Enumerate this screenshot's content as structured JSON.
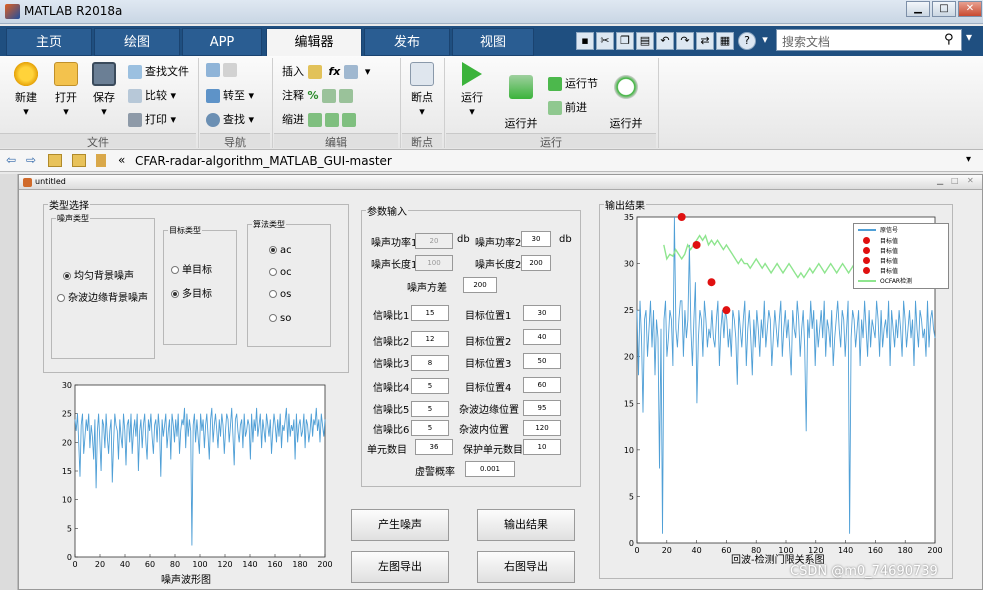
{
  "window": {
    "title": "MATLAB R2018a",
    "min": "▁",
    "max": "□",
    "close": "✕"
  },
  "tabs": [
    {
      "label": "主页"
    },
    {
      "label": "绘图"
    },
    {
      "label": "APP"
    },
    {
      "label": "编辑器"
    },
    {
      "label": "发布"
    },
    {
      "label": "视图"
    }
  ],
  "search": {
    "placeholder": "搜索文档"
  },
  "ribbon": {
    "file": {
      "new": "新建",
      "open": "打开",
      "save": "保存",
      "find_files": "查找文件",
      "compare": "比较",
      "print": "打印",
      "group": "文件"
    },
    "nav": {
      "goto": "转至",
      "find": "查找",
      "group": "导航"
    },
    "edit": {
      "insert": "插入",
      "comment": "注释",
      "indent": "缩进",
      "fx": "fx",
      "group": "编辑"
    },
    "breakpoint": {
      "label": "断点",
      "group": "断点"
    },
    "run": {
      "run": "运行",
      "run_advance": "运行并\n前进",
      "run_section": "运行节",
      "advance": "前进",
      "run_time": "运行并\n计时",
      "group": "运行"
    }
  },
  "path": {
    "text": "CFAR-radar-algorithm_MATLAB_GUI-master",
    "chev": "«"
  },
  "figure": {
    "title": "untitled"
  },
  "type_panel": {
    "title": "类型选择",
    "noise": {
      "title": "噪声类型",
      "options": [
        "均匀背景噪声",
        "杂波边缘背景噪声"
      ]
    },
    "target": {
      "title": "目标类型",
      "options": [
        "单目标",
        "多目标"
      ]
    },
    "algo": {
      "title": "算法类型",
      "options": [
        "ac",
        "oc",
        "os",
        "so"
      ]
    }
  },
  "params": {
    "title": "参数输入",
    "noise_power1": {
      "label": "噪声功率1",
      "value": "20",
      "unit": "db"
    },
    "noise_power2": {
      "label": "噪声功率2",
      "value": "30",
      "unit": "db"
    },
    "noise_len1": {
      "label": "噪声长度1",
      "value": "100"
    },
    "noise_len2": {
      "label": "噪声长度2",
      "value": "200"
    },
    "noise_var": {
      "label": "噪声方差",
      "value": "200"
    },
    "snr": [
      {
        "label": "信噪比1",
        "value": "15"
      },
      {
        "label": "信噪比2",
        "value": "12"
      },
      {
        "label": "信噪比3",
        "value": "8"
      },
      {
        "label": "信噪比4",
        "value": "5"
      },
      {
        "label": "信噪比5",
        "value": "5"
      },
      {
        "label": "信噪比6",
        "value": "5"
      }
    ],
    "pos": [
      {
        "label": "目标位置1",
        "value": "30"
      },
      {
        "label": "目标位置2",
        "value": "40"
      },
      {
        "label": "目标位置3",
        "value": "50"
      },
      {
        "label": "目标位置4",
        "value": "60"
      },
      {
        "label": "杂波边缘位置",
        "value": "95"
      },
      {
        "label": "杂波内位置",
        "value": "120"
      }
    ],
    "cells": {
      "label": "单元数目",
      "value": "36"
    },
    "guard": {
      "label": "保护单元数目",
      "value": "10"
    },
    "pfa": {
      "label": "虚警概率",
      "value": "0.001"
    }
  },
  "buttons": {
    "gen_noise": "产生噪声",
    "output": "输出结果",
    "left_export": "左图导出",
    "right_export": "右图导出"
  },
  "chart_data": [
    {
      "type": "line",
      "title": "",
      "xlabel": "噪声波形图",
      "ylabel": "",
      "xlim": [
        0,
        200
      ],
      "ylim": [
        0,
        30
      ],
      "xticks": [
        "0",
        "20",
        "40",
        "60",
        "80",
        "100",
        "120",
        "140",
        "160",
        "180",
        "200"
      ],
      "yticks": [
        "0",
        "5",
        "10",
        "15",
        "20",
        "25",
        "30"
      ],
      "series": [
        {
          "color": "#4f9fd6",
          "values": [
            24,
            22,
            25,
            20,
            14,
            23,
            25,
            18,
            21,
            24,
            22,
            25,
            19,
            23,
            21,
            17,
            24,
            12,
            22,
            25,
            20,
            15,
            24,
            23,
            19,
            25,
            21,
            18,
            22,
            24,
            13,
            20,
            25,
            23,
            22,
            17,
            24,
            21,
            19,
            25,
            22,
            16,
            23,
            24,
            20,
            25,
            18,
            22,
            24,
            21,
            25,
            15,
            22,
            24,
            19,
            23,
            25,
            20,
            17,
            24,
            22,
            25,
            21,
            18,
            23,
            24,
            20,
            25,
            22,
            14,
            24,
            21,
            23,
            25,
            19,
            22,
            24,
            17,
            25,
            23,
            20,
            24,
            21,
            25,
            18,
            22,
            24,
            23,
            26,
            19,
            25,
            21,
            24,
            22,
            2,
            23,
            25,
            20,
            24,
            21,
            18,
            25,
            22,
            24,
            19,
            23,
            25,
            21,
            17,
            24,
            26,
            20,
            23,
            25,
            22,
            19,
            24,
            21,
            25,
            23,
            18,
            22,
            25,
            24,
            20,
            23,
            26,
            21,
            16,
            24,
            25,
            22,
            20,
            23,
            24,
            19,
            25,
            21,
            22,
            24,
            23,
            17,
            25,
            20,
            24,
            22,
            26,
            21,
            23,
            25,
            19,
            24,
            22,
            20,
            25,
            23,
            21,
            24,
            18,
            22,
            25,
            23,
            20,
            24,
            21,
            25,
            19,
            23,
            22,
            24,
            26,
            20,
            25,
            21,
            23,
            22,
            24,
            17,
            25,
            20,
            23,
            24,
            21,
            22,
            25,
            19,
            24,
            23,
            20,
            22,
            25,
            21,
            24,
            23,
            26,
            22,
            24,
            20,
            25,
            23,
            21,
            24
          ]
        }
      ]
    },
    {
      "type": "line",
      "title": "输出结果",
      "xlabel": "回波-检测门限关系图",
      "ylabel": "",
      "xlim": [
        0,
        200
      ],
      "ylim": [
        0,
        35
      ],
      "xticks": [
        "0",
        "20",
        "40",
        "60",
        "80",
        "100",
        "120",
        "140",
        "160",
        "180",
        "200"
      ],
      "yticks": [
        "0",
        "5",
        "10",
        "15",
        "20",
        "25",
        "30",
        "35"
      ],
      "legend": {
        "placement": "top-right",
        "entries": [
          "原信号",
          "目标值",
          "目标值",
          "目标值",
          "目标值",
          "OCFAR检测"
        ]
      },
      "series": [
        {
          "name": "原信号",
          "color": "#4f9fd6",
          "values": [
            25,
            18,
            26,
            22,
            14,
            24,
            25,
            20,
            23,
            26,
            21,
            25,
            18,
            24,
            22,
            8,
            23,
            1,
            24,
            26,
            20,
            22,
            25,
            24,
            19,
            35,
            23,
            21,
            24,
            26,
            26,
            20,
            25,
            22,
            24,
            32,
            23,
            19,
            24,
            28,
            15,
            22,
            25,
            24,
            20,
            26,
            24,
            21,
            23,
            22,
            25,
            22,
            21,
            24,
            26,
            19,
            23,
            25,
            22,
            25,
            24,
            21,
            23,
            20,
            25,
            24,
            22,
            17,
            25,
            23,
            21,
            24,
            26,
            19,
            23,
            25,
            22,
            18,
            24,
            21,
            25,
            23,
            20,
            24,
            22,
            26,
            21,
            23,
            25,
            24,
            19,
            22,
            25,
            23,
            21,
            24,
            26,
            20,
            23,
            25,
            22,
            24,
            21,
            18,
            25,
            23,
            22,
            26,
            24,
            20,
            23,
            25,
            21,
            12,
            24,
            22,
            26,
            23,
            25,
            19,
            24,
            21,
            23,
            25,
            22,
            26,
            20,
            24,
            23,
            21,
            25,
            19,
            22,
            24,
            26,
            23,
            21,
            25,
            24,
            20,
            23,
            26,
            1,
            22,
            25,
            24,
            21,
            23,
            25,
            19,
            24,
            22,
            26,
            23,
            20,
            25,
            21,
            24,
            23,
            22,
            26,
            24,
            20,
            25,
            21,
            23,
            24,
            22,
            26,
            19,
            25,
            23,
            21,
            24,
            22,
            25,
            23,
            20,
            26,
            24,
            21,
            23,
            25,
            22,
            24,
            19,
            26,
            23,
            21,
            25,
            24,
            22,
            23,
            20,
            26,
            21,
            24,
            25,
            23,
            22
          ]
        },
        {
          "name": "OCFAR检测",
          "color": "#8ee58e",
          "x": [
            18,
            20,
            22,
            24,
            26,
            28,
            30,
            32,
            34,
            36,
            38,
            40,
            42,
            44,
            46,
            48,
            50,
            52,
            54,
            56,
            58,
            60,
            62,
            64,
            66,
            68,
            70,
            72,
            74,
            76,
            78,
            80,
            82,
            84,
            86,
            88,
            90,
            92,
            94,
            96,
            98,
            100,
            102,
            104,
            106,
            108,
            110,
            112,
            114,
            116,
            118,
            120,
            122,
            124,
            126,
            128,
            130,
            132,
            134,
            136,
            138,
            140,
            142,
            144,
            146,
            148,
            150,
            152,
            154,
            156,
            158,
            160,
            162,
            164,
            166,
            168,
            170,
            172,
            174,
            176,
            178,
            180
          ],
          "values": [
            32,
            30.5,
            31,
            30.8,
            31.5,
            31,
            30.5,
            31,
            32,
            31.5,
            32,
            32.5,
            33,
            32.5,
            33,
            32,
            32.5,
            32,
            32.5,
            32,
            31.5,
            32,
            31.5,
            31,
            30.5,
            30,
            30.5,
            30,
            30,
            29.5,
            30,
            30.5,
            30,
            29.5,
            30,
            29.5,
            29,
            29.5,
            30,
            29.5,
            29,
            29.5,
            30,
            29.5,
            29,
            28.5,
            29,
            28.5,
            29,
            29.5,
            29,
            29.5,
            30,
            29.5,
            29,
            29.5,
            30,
            29.5,
            29,
            29.5,
            30,
            29.5,
            29,
            29.5,
            30,
            29.5,
            29.5,
            30,
            29.5,
            29,
            29.5,
            30,
            30.5,
            30,
            29.5,
            29,
            29.5,
            30,
            29.5,
            29,
            29.5,
            30
          ]
        },
        {
          "name": "目标值",
          "type": "scatter",
          "color": "#e01010",
          "x": [
            30,
            40,
            50,
            60
          ],
          "values": [
            35,
            32,
            28,
            25
          ]
        }
      ]
    }
  ]
}
